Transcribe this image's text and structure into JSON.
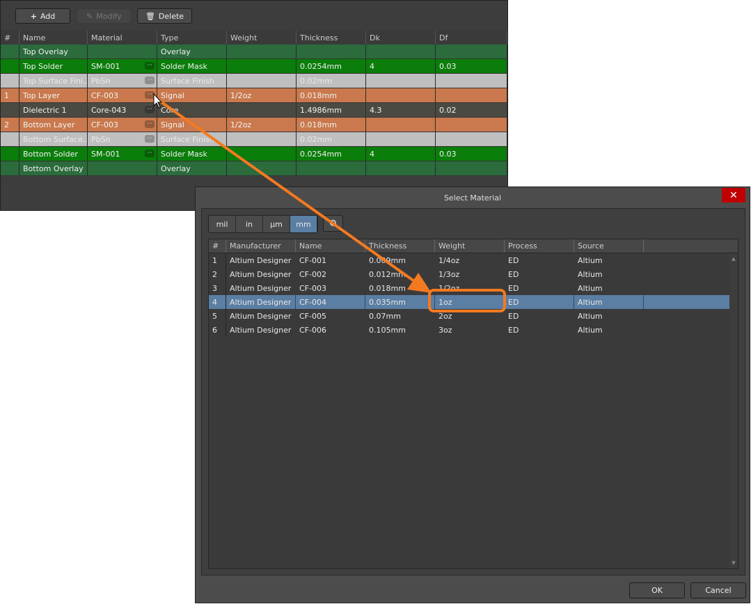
{
  "toolbar": {
    "add": "Add",
    "modify": "Modify",
    "delete": "Delete"
  },
  "stack": {
    "columns": [
      "#",
      "Name",
      "Material",
      "Type",
      "Weight",
      "Thickness",
      "Dk",
      "Df"
    ],
    "rows": [
      {
        "num": "",
        "name": "Top Overlay",
        "material": "",
        "type": "Overlay",
        "weight": "",
        "thickness": "",
        "dk": "",
        "df": "",
        "kind": "overlay"
      },
      {
        "num": "",
        "name": "Top Solder",
        "material": "SM-001",
        "type": "Solder Mask",
        "weight": "",
        "thickness": "0.0254mm",
        "dk": "4",
        "df": "0.03",
        "kind": "solder"
      },
      {
        "num": "",
        "name": "Top Surface Fini...",
        "material": "PbSn",
        "type": "Surface Finish",
        "weight": "",
        "thickness": "0.02mm",
        "dk": "",
        "df": "",
        "kind": "finish"
      },
      {
        "num": "1",
        "name": "Top Layer",
        "material": "CF-003",
        "type": "Signal",
        "weight": "1/2oz",
        "thickness": "0.018mm",
        "dk": "",
        "df": "",
        "kind": "signal"
      },
      {
        "num": "",
        "name": "Dielectric 1",
        "material": "Core-043",
        "type": "Core",
        "weight": "",
        "thickness": "1.4986mm",
        "dk": "4.3",
        "df": "0.02",
        "kind": "core"
      },
      {
        "num": "2",
        "name": "Bottom Layer",
        "material": "CF-003",
        "type": "Signal",
        "weight": "1/2oz",
        "thickness": "0.018mm",
        "dk": "",
        "df": "",
        "kind": "signal"
      },
      {
        "num": "",
        "name": "Bottom Surface...",
        "material": "PbSn",
        "type": "Surface Finish",
        "weight": "",
        "thickness": "0.02mm",
        "dk": "",
        "df": "",
        "kind": "finish"
      },
      {
        "num": "",
        "name": "Bottom Solder",
        "material": "SM-001",
        "type": "Solder Mask",
        "weight": "",
        "thickness": "0.0254mm",
        "dk": "4",
        "df": "0.03",
        "kind": "solder"
      },
      {
        "num": "",
        "name": "Bottom Overlay",
        "material": "",
        "type": "Overlay",
        "weight": "",
        "thickness": "",
        "dk": "",
        "df": "",
        "kind": "overlay"
      }
    ]
  },
  "colors": {
    "overlay": "#2b6b3c",
    "solder": "#0a7d0a",
    "finish": "#bfbfbf",
    "signal": "#c9794d",
    "core": "#4b4a42",
    "selected": "#5b7ea3",
    "accent": "#f47a20",
    "close": "#c00000"
  },
  "dialog": {
    "title": "Select Material",
    "units": [
      "mil",
      "in",
      "µm",
      "mm"
    ],
    "active_unit": "mm",
    "columns": [
      "#",
      "Manufacturer",
      "Name",
      "Thickness",
      "Weight",
      "Process",
      "Source"
    ],
    "rows": [
      [
        "1",
        "Altium Designer",
        "CF-001",
        "0.009mm",
        "1/4oz",
        "ED",
        "Altium"
      ],
      [
        "2",
        "Altium Designer",
        "CF-002",
        "0.012mm",
        "1/3oz",
        "ED",
        "Altium"
      ],
      [
        "3",
        "Altium Designer",
        "CF-003",
        "0.018mm",
        "1/2oz",
        "ED",
        "Altium"
      ],
      [
        "4",
        "Altium Designer",
        "CF-004",
        "0.035mm",
        "1oz",
        "ED",
        "Altium"
      ],
      [
        "5",
        "Altium Designer",
        "CF-005",
        "0.07mm",
        "2oz",
        "ED",
        "Altium"
      ],
      [
        "6",
        "Altium Designer",
        "CF-006",
        "0.105mm",
        "3oz",
        "ED",
        "Altium"
      ]
    ],
    "selected_index": 3,
    "ok": "OK",
    "cancel": "Cancel"
  }
}
